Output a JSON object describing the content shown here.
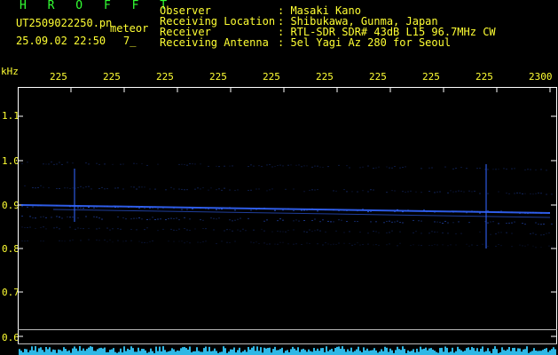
{
  "app_title": "H R O F F T",
  "file_name": "UT2509022250.pn",
  "meteor_label": "meteor",
  "date_time": "25.09.02 22:50",
  "count_label": "7_",
  "header": {
    "labels": [
      "Observer",
      "Receiving Location",
      "Receiver",
      "Receiving Antenna"
    ],
    "values": [
      ": Masaki Kano",
      ": Shibukawa, Gunma, Japan",
      ": RTL-SDR SDR# 43dB L15 96.7MHz CW",
      ": 5el Yagi Az 280 for Seoul"
    ]
  },
  "axis": {
    "y_unit": "kHz",
    "y_ticks": [
      "1.1",
      "1.0",
      "0.9",
      "0.8",
      "0.7",
      "0.6"
    ],
    "x_ticks": [
      "225",
      "225",
      "225",
      "225",
      "225",
      "225",
      "225",
      "225",
      "225",
      "2300"
    ]
  },
  "colors": {
    "title": "#33ff33",
    "text": "#ffff33",
    "signal": "#3366ff",
    "noise": "#33ccff"
  }
}
